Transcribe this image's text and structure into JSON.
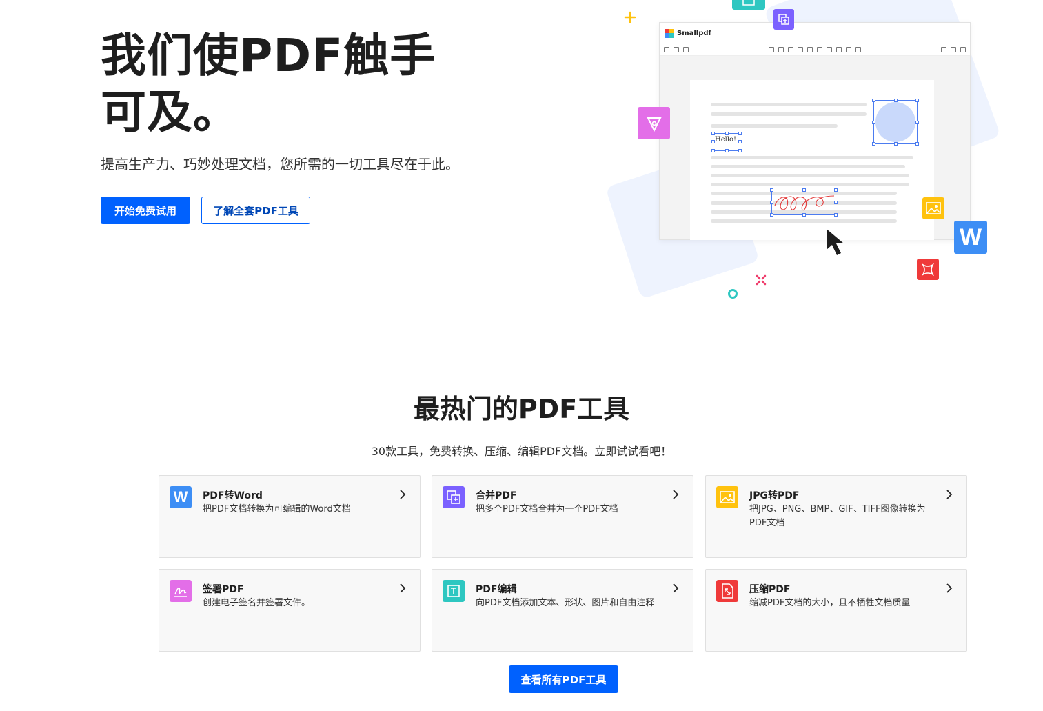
{
  "hero": {
    "title": "我们使PDF触手可及。",
    "subtitle": "提高生产力、巧妙处理文档，您所需的一切工具尽在于此。",
    "primary_cta": "开始免费试用",
    "secondary_cta": "了解全套PDF工具"
  },
  "illustration": {
    "app_name": "Smallpdf",
    "hello_text": "Hello!",
    "word_letter": "W",
    "colors": {
      "bg_shape": "#eef3fe",
      "purple": "#7b61ff",
      "magenta": "#e36ee8",
      "teal": "#2ec7c1",
      "yellow": "#ffc20e",
      "blue_word": "#3d8ef5",
      "red": "#ef3a3a"
    }
  },
  "tools": {
    "title": "最热门的PDF工具",
    "subtitle": "30款工具，免费转换、压缩、编辑PDF文档。立即试试看吧！",
    "items": [
      {
        "name": "PDF转Word",
        "desc": "把PDF文档转换为可编辑的Word文档",
        "icon": "word-icon",
        "color": "#3d8ef5"
      },
      {
        "name": "合并PDF",
        "desc": "把多个PDF文档合并为一个PDF文档",
        "icon": "merge-icon",
        "color": "#7b61ff"
      },
      {
        "name": "JPG转PDF",
        "desc": "把JPG、PNG、BMP、GIF、TIFF图像转换为PDF文档",
        "icon": "image-icon",
        "color": "#ffc20e"
      },
      {
        "name": "签署PDF",
        "desc": "创建电子签名并签署文件。",
        "icon": "signature-icon",
        "color": "#e36ee8"
      },
      {
        "name": "PDF编辑",
        "desc": "向PDF文档添加文本、形状、图片和自由注释",
        "icon": "edit-text-icon",
        "color": "#2ec7c1"
      },
      {
        "name": "压缩PDF",
        "desc": "缩减PDF文档的大小，且不牺牲文档质量",
        "icon": "compress-icon",
        "color": "#ef3a3a"
      }
    ],
    "view_all": "查看所有PDF工具"
  },
  "brand_color": "#0061fe"
}
